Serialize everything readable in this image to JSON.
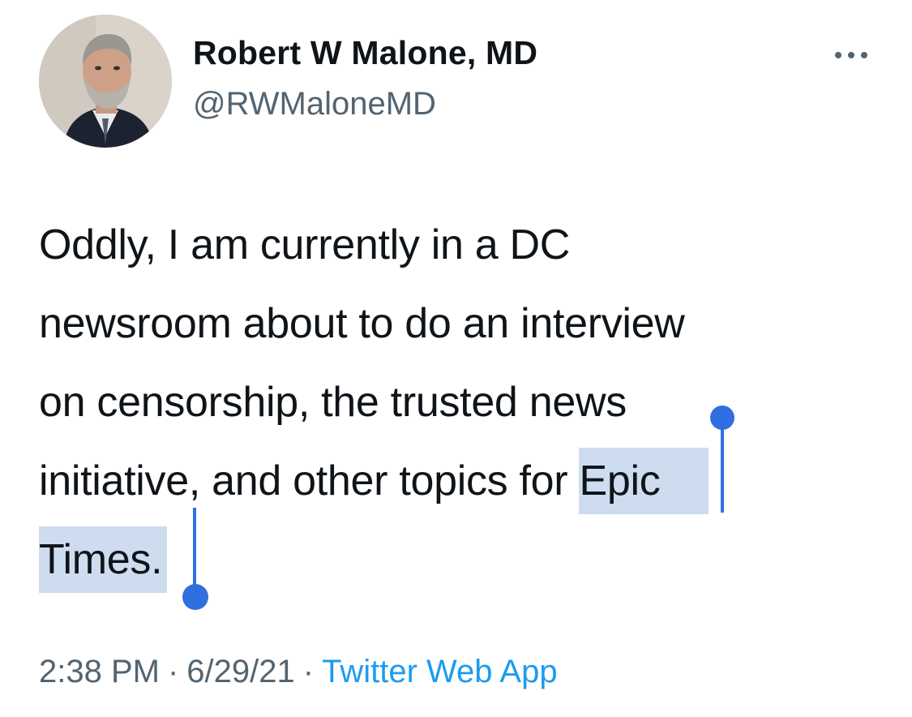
{
  "tweet": {
    "author": {
      "display_name": "Robert W Malone, MD",
      "handle": "@RWMaloneMD",
      "avatar_icon": "profile-photo"
    },
    "more_icon": "more-options-icon",
    "text_lines": {
      "l1": "Oddly, I am currently in a DC",
      "l2": "newsroom about to do an interview",
      "l3": "on censorship, the trusted news",
      "l4_plain": "initiative, and other topics for ",
      "l4_selected": "Epic",
      "l5_selected": "Times."
    },
    "selection_color": "#cddcee",
    "selection_handle_color": "#2f6fe0",
    "meta": {
      "time": "2:38 PM",
      "separator1": "·",
      "date": "6/29/21",
      "separator2": "·",
      "source": "Twitter Web App"
    },
    "colors": {
      "text": "#0f1419",
      "secondary": "#536471",
      "link": "#1d9bf0"
    }
  }
}
